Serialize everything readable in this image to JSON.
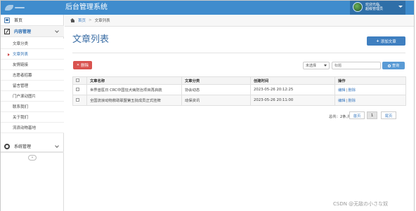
{
  "header": {
    "app_title": "后台管理系统",
    "user_line1": "欢迎光临,",
    "user_line2": "超级管理员"
  },
  "sidebar": {
    "home_label": "首页",
    "content_label": "内容管理",
    "sub_items": [
      {
        "label": "文章分类"
      },
      {
        "label": "文章列表"
      },
      {
        "label": "友情链接"
      },
      {
        "label": "志愿者招募"
      },
      {
        "label": "留言管理"
      },
      {
        "label": "门户滚动图片"
      },
      {
        "label": "联系我们"
      },
      {
        "label": "关于我们"
      },
      {
        "label": "流浪动物基地"
      }
    ],
    "system_label": "系统管理",
    "collapse_symbol": "«"
  },
  "breadcrumb": {
    "home": "首页",
    "separator": ">",
    "current": "文章列表"
  },
  "main": {
    "page_title": "文章列表",
    "add_button": "添加文章",
    "add_symbol": "+",
    "delete_button": "删除",
    "delete_symbol": "✕",
    "select_value": "未选择",
    "search_placeholder": "标题",
    "search_button": "查询"
  },
  "table": {
    "headers": [
      "文章名称",
      "文章分类",
      "创建时间",
      "操作"
    ],
    "rows": [
      {
        "name": "世界兽医日 CRC中国狂犬病防治项目再启航",
        "category": "协会动态",
        "created": "2023-05-26 20:12:25",
        "edit": "编辑",
        "sep": "|",
        "delete": "删除"
      },
      {
        "name": "全国流浪动物救助联盟第五批成员正式挂牌",
        "category": "动保资讯",
        "created": "2023-05-26 20:11:00",
        "edit": "编辑",
        "sep": "|",
        "delete": "删除"
      }
    ]
  },
  "pagination": {
    "info": "总共：2条,共:1页",
    "first": "首页",
    "page": "1",
    "last": "尾页"
  },
  "watermark": "CSDN @无敌の小さな奴",
  "colors": {
    "topbar": "#3f8ccd",
    "primary": "#3f7fc0",
    "danger": "#d9534f",
    "link": "#3a79c0"
  }
}
